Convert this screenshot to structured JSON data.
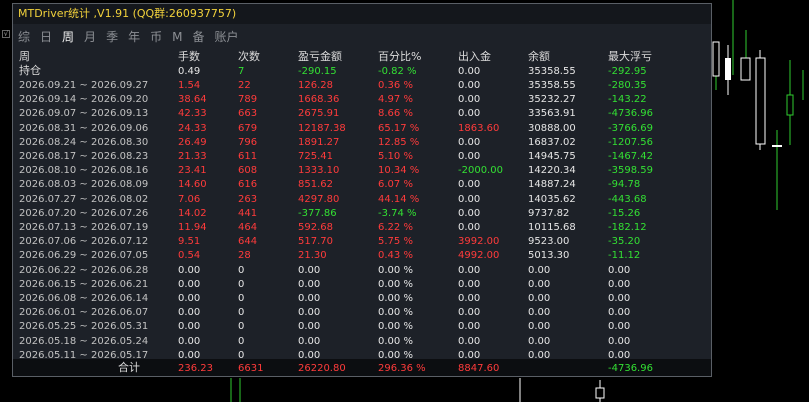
{
  "window": {
    "title": "MTDriver统计 ,V1.91 (QQ群:260937757)"
  },
  "tabs": [
    {
      "label": "综",
      "active": false
    },
    {
      "label": "日",
      "active": false
    },
    {
      "label": "周",
      "active": true
    },
    {
      "label": "月",
      "active": false
    },
    {
      "label": "季",
      "active": false
    },
    {
      "label": "年",
      "active": false
    },
    {
      "label": "币",
      "active": false
    },
    {
      "label": "M",
      "active": false
    },
    {
      "label": "备",
      "active": false
    },
    {
      "label": "账户",
      "active": false
    }
  ],
  "table": {
    "headers": [
      "周",
      "手数",
      "次数",
      "盈亏金额",
      "百分比%",
      "出入金",
      "余额",
      "最大浮亏"
    ],
    "holding": {
      "label": "持仓",
      "values": [
        "0.49",
        "7",
        "-290.15",
        "-0.82 %",
        "0.00",
        "35358.55",
        "-292.95"
      ]
    },
    "rows": [
      [
        "2026.09.21 ~ 2026.09.27",
        "1.54",
        "22",
        "126.28",
        "0.36 %",
        "0.00",
        "35358.55",
        "-280.35"
      ],
      [
        "2026.09.14 ~ 2026.09.20",
        "38.64",
        "789",
        "1668.36",
        "4.97 %",
        "0.00",
        "35232.27",
        "-143.22"
      ],
      [
        "2026.09.07 ~ 2026.09.13",
        "42.33",
        "663",
        "2675.91",
        "8.66 %",
        "0.00",
        "33563.91",
        "-4736.96"
      ],
      [
        "2026.08.31 ~ 2026.09.06",
        "24.33",
        "679",
        "12187.38",
        "65.17 %",
        "1863.60",
        "30888.00",
        "-3766.69"
      ],
      [
        "2026.08.24 ~ 2026.08.30",
        "26.49",
        "796",
        "1891.27",
        "12.85 %",
        "0.00",
        "16837.02",
        "-1207.56"
      ],
      [
        "2026.08.17 ~ 2026.08.23",
        "21.33",
        "611",
        "725.41",
        "5.10 %",
        "0.00",
        "14945.75",
        "-1467.42"
      ],
      [
        "2026.08.10 ~ 2026.08.16",
        "23.41",
        "608",
        "1333.10",
        "10.34 %",
        "-2000.00",
        "14220.34",
        "-3598.59"
      ],
      [
        "2026.08.03 ~ 2026.08.09",
        "14.60",
        "616",
        "851.62",
        "6.07 %",
        "0.00",
        "14887.24",
        "-94.78"
      ],
      [
        "2026.07.27 ~ 2026.08.02",
        "7.06",
        "263",
        "4297.80",
        "44.14 %",
        "0.00",
        "14035.62",
        "-443.68"
      ],
      [
        "2026.07.20 ~ 2026.07.26",
        "14.02",
        "441",
        "-377.86",
        "-3.74 %",
        "0.00",
        "9737.82",
        "-15.26"
      ],
      [
        "2026.07.13 ~ 2026.07.19",
        "11.94",
        "464",
        "592.68",
        "6.22 %",
        "0.00",
        "10115.68",
        "-182.12"
      ],
      [
        "2026.07.06 ~ 2026.07.12",
        "9.51",
        "644",
        "517.70",
        "5.75 %",
        "3992.00",
        "9523.00",
        "-35.20"
      ],
      [
        "2026.06.29 ~ 2026.07.05",
        "0.54",
        "28",
        "21.30",
        "0.43 %",
        "4992.00",
        "5013.30",
        "-11.12"
      ],
      [
        "2026.06.22 ~ 2026.06.28",
        "0.00",
        "0",
        "0.00",
        "0.00 %",
        "0.00",
        "0.00",
        "0.00"
      ],
      [
        "2026.06.15 ~ 2026.06.21",
        "0.00",
        "0",
        "0.00",
        "0.00 %",
        "0.00",
        "0.00",
        "0.00"
      ],
      [
        "2026.06.08 ~ 2026.06.14",
        "0.00",
        "0",
        "0.00",
        "0.00 %",
        "0.00",
        "0.00",
        "0.00"
      ],
      [
        "2026.06.01 ~ 2026.06.07",
        "0.00",
        "0",
        "0.00",
        "0.00 %",
        "0.00",
        "0.00",
        "0.00"
      ],
      [
        "2026.05.25 ~ 2026.05.31",
        "0.00",
        "0",
        "0.00",
        "0.00 %",
        "0.00",
        "0.00",
        "0.00"
      ],
      [
        "2026.05.18 ~ 2026.05.24",
        "0.00",
        "0",
        "0.00",
        "0.00 %",
        "0.00",
        "0.00",
        "0.00"
      ],
      [
        "2026.05.11 ~ 2026.05.17",
        "0.00",
        "0",
        "0.00",
        "0.00 %",
        "0.00",
        "0.00",
        "0.00"
      ]
    ],
    "total": {
      "label": "合计",
      "values": [
        "236.23",
        "6631",
        "26220.80",
        "296.36 %",
        "8847.60",
        "",
        "-4736.96"
      ]
    }
  },
  "colors": {
    "profit": "#ff3b3b",
    "loss": "#33e033",
    "title": "#f2d23c",
    "panel": "#1d2128",
    "candle_bear": "#ffffff",
    "candle_bull": "#2fcc2f"
  }
}
